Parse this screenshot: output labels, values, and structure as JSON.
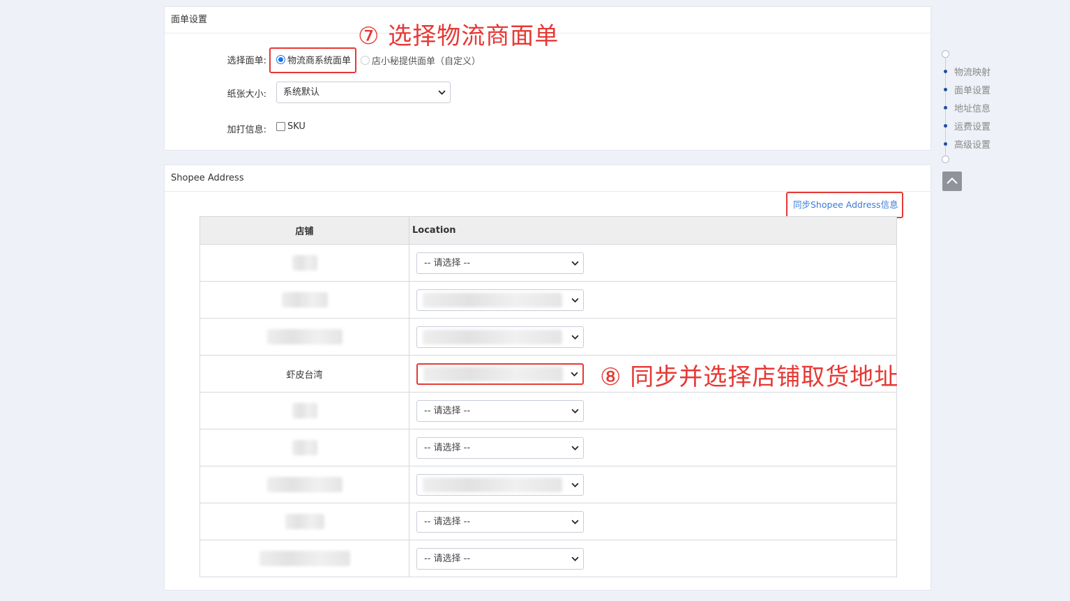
{
  "panel1": {
    "title": "面单设置",
    "label_select": "选择面单:",
    "radio_option_1": "物流商系统面单",
    "radio_option_2": "店小秘提供面单（自定义）",
    "label_paper": "纸张大小:",
    "paper_value": "系统默认",
    "label_extra": "加打信息:",
    "extra_checkbox": "SKU"
  },
  "annotation_7": "⑦ 选择物流商面单",
  "annotation_8": "⑧ 同步并选择店铺取货地址",
  "panel2": {
    "title": "Shopee Address",
    "sync_link": "同步Shopee Address信息",
    "col_shop": "店铺",
    "col_location": "Location",
    "rows": [
      {
        "shop": "",
        "location": "-- 请选择 --"
      },
      {
        "shop": "",
        "location": ""
      },
      {
        "shop": "",
        "location": ""
      },
      {
        "shop": "虾皮台湾",
        "location": ""
      },
      {
        "shop": "",
        "location": "-- 请选择 --"
      },
      {
        "shop": "",
        "location": "-- 请选择 --"
      },
      {
        "shop": "",
        "location": ""
      },
      {
        "shop": "",
        "location": "-- 请选择 --"
      },
      {
        "shop": "",
        "location": "-- 请选择 --"
      }
    ]
  },
  "nav": {
    "items": [
      "物流映射",
      "面单设置",
      "地址信息",
      "运费设置",
      "高级设置"
    ]
  },
  "colors": {
    "annotation_red": "#e53935",
    "link_blue": "#3a7bd5",
    "nav_dot": "#1f4ea3"
  }
}
